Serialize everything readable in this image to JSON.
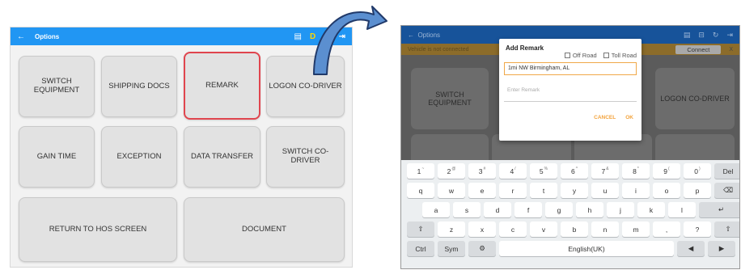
{
  "left_screen": {
    "appbar": {
      "back_icon": "arrow-left-icon",
      "title": "Options",
      "status_icons": [
        "message-icon",
        "d-status",
        "ethernet-icon",
        "logout-icon"
      ],
      "d_label": "D"
    },
    "buttons": [
      {
        "label": "SWITCH\nEQUIPMENT",
        "selected": false
      },
      {
        "label": "SHIPPING DOCS",
        "selected": false
      },
      {
        "label": "REMARK",
        "selected": true
      },
      {
        "label": "LOGON CO-DRIVER",
        "selected": false
      },
      {
        "label": "GAIN TIME",
        "selected": false
      },
      {
        "label": "EXCEPTION",
        "selected": false
      },
      {
        "label": "DATA TRANSFER",
        "selected": false
      },
      {
        "label": "SWITCH CO-\nDRIVER",
        "selected": false
      },
      {
        "label": "RETURN TO HOS SCREEN",
        "selected": false
      },
      {
        "label": "DOCUMENT",
        "selected": false
      }
    ],
    "accent": "#2196f3",
    "selected_border": "#e0454e"
  },
  "right_screen": {
    "appbar_title": "Options",
    "warning_text": "Vehicle is not connected",
    "connect_label": "Connect",
    "close_label": "X",
    "bg_buttons": [
      "SWITCH\nEQUIPMENT",
      "LOGON CO-DRIVER"
    ],
    "dialog": {
      "title": "Add Remark",
      "off_road_label": "Off Road",
      "toll_road_label": "Toll Road",
      "location_value": "1mi NW Birmingham, AL",
      "remark_placeholder": "Enter Remark",
      "cancel_label": "CANCEL",
      "ok_label": "OK"
    },
    "keyboard": {
      "row1": [
        [
          "1",
          "~"
        ],
        [
          "2",
          "@"
        ],
        [
          "3",
          "#"
        ],
        [
          "4",
          "/"
        ],
        [
          "5",
          "%"
        ],
        [
          "6",
          "^"
        ],
        [
          "7",
          "&"
        ],
        [
          "8",
          "*"
        ],
        [
          "9",
          "("
        ],
        [
          "0",
          ")"
        ],
        [
          "Del",
          ""
        ]
      ],
      "row2": [
        "q",
        "w",
        "e",
        "r",
        "t",
        "y",
        "u",
        "i",
        "o",
        "p",
        "⌫"
      ],
      "row3": [
        "a",
        "s",
        "d",
        "f",
        "g",
        "h",
        "j",
        "k",
        "l",
        "↵"
      ],
      "row4": [
        "⇧",
        "z",
        "x",
        "c",
        "v",
        "b",
        "n",
        "m",
        ",",
        "?",
        "⇧"
      ],
      "row5": [
        "Ctrl",
        "Sym",
        "⚙",
        "English(UK)",
        "◀",
        "▶"
      ]
    },
    "accent": "#17539a"
  }
}
